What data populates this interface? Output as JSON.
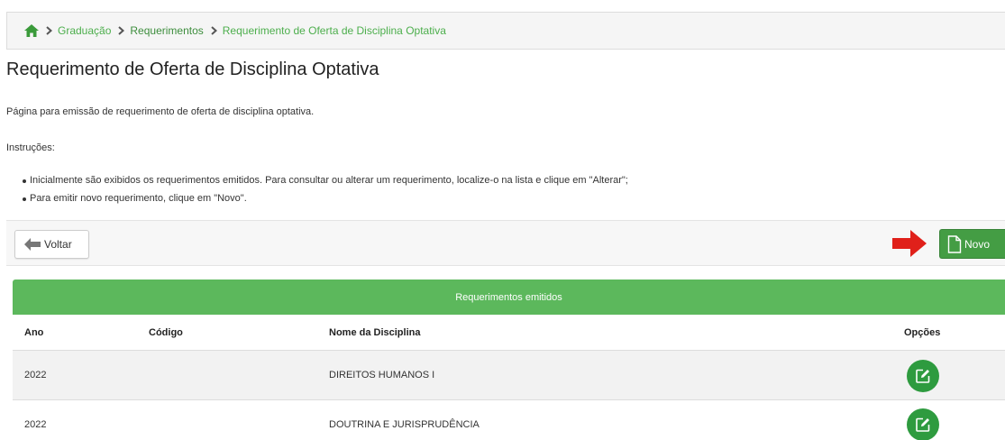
{
  "breadcrumb": {
    "items": [
      "Graduação",
      "Requerimentos",
      "Requerimento de Oferta de Disciplina Optativa"
    ]
  },
  "page": {
    "title": "Requerimento de Oferta de Disciplina Optativa",
    "description": "Página para emissão de requerimento de oferta de disciplina optativa.",
    "instructions_label": "Instruções:",
    "instructions": [
      "Inicialmente são exibidos os requerimentos emitidos. Para consultar ou alterar um requerimento, localize-o na lista e clique em \"Alterar\";",
      "Para emitir novo requerimento, clique em \"Novo\"."
    ]
  },
  "toolbar": {
    "back_label": "Voltar",
    "new_label": "Novo"
  },
  "table": {
    "title": "Requerimentos emitidos",
    "columns": [
      "Ano",
      "Código",
      "Nome da Disciplina",
      "Opções"
    ],
    "rows": [
      {
        "ano": "2022",
        "codigo": "",
        "nome": "DIREITOS HUMANOS I"
      },
      {
        "ano": "2022",
        "codigo": "",
        "nome": "DOUTRINA E JURISPRUDÊNCIA"
      }
    ]
  },
  "icons": {
    "home": "home-icon",
    "separator": "chevron-right-icon",
    "back": "arrow-left-icon",
    "new": "document-icon",
    "edit": "edit-icon",
    "pointer": "red-arrow-icon"
  },
  "colors": {
    "accent": "#5cb85c",
    "button_green": "#449d44",
    "edit_green": "#2e9b3f",
    "pointer_red": "#e0201a"
  }
}
